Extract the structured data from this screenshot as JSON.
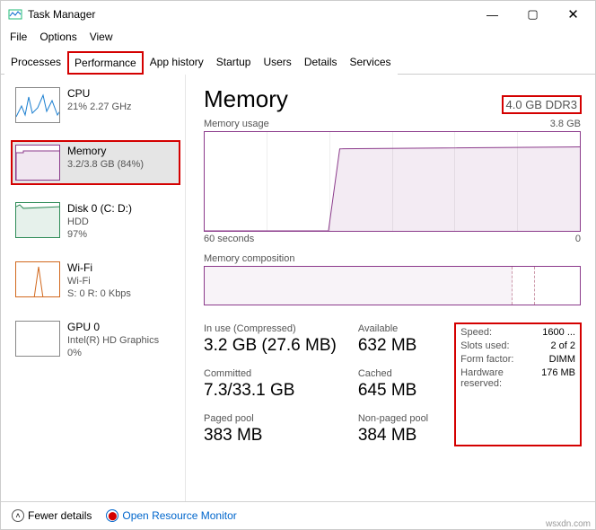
{
  "window": {
    "title": "Task Manager"
  },
  "window_controls": {
    "min": "—",
    "max": "▢",
    "close": "✕"
  },
  "menu": {
    "file": "File",
    "options": "Options",
    "view": "View"
  },
  "tabs": {
    "processes": "Processes",
    "performance": "Performance",
    "app_history": "App history",
    "startup": "Startup",
    "users": "Users",
    "details": "Details",
    "services": "Services"
  },
  "sidebar": {
    "cpu": {
      "title": "CPU",
      "sub": "21%  2.27 GHz"
    },
    "memory": {
      "title": "Memory",
      "sub": "3.2/3.8 GB (84%)"
    },
    "disk": {
      "title": "Disk 0 (C: D:)",
      "sub1": "HDD",
      "sub2": "97%"
    },
    "wifi": {
      "title": "Wi-Fi",
      "sub1": "Wi-Fi",
      "sub2": "S: 0 R: 0 Kbps"
    },
    "gpu": {
      "title": "GPU 0",
      "sub1": "Intel(R) HD Graphics",
      "sub2": "0%"
    }
  },
  "main": {
    "title": "Memory",
    "capacity": "4.0 GB DDR3",
    "usage_label": "Memory usage",
    "usage_max": "3.8 GB",
    "axis_left": "60 seconds",
    "axis_right": "0",
    "comp_label": "Memory composition"
  },
  "stats_left": {
    "in_use_lbl": "In use (Compressed)",
    "in_use_val": "3.2 GB (27.6 MB)",
    "avail_lbl": "Available",
    "avail_val": "632 MB",
    "committed_lbl": "Committed",
    "committed_val": "7.3/33.1 GB",
    "cached_lbl": "Cached",
    "cached_val": "645 MB",
    "paged_lbl": "Paged pool",
    "paged_val": "383 MB",
    "nonpaged_lbl": "Non-paged pool",
    "nonpaged_val": "384 MB"
  },
  "stats_right": {
    "speed_k": "Speed:",
    "speed_v": "1600 ...",
    "slots_k": "Slots used:",
    "slots_v": "2 of 2",
    "form_k": "Form factor:",
    "form_v": "DIMM",
    "hw_k": "Hardware reserved:",
    "hw_v": "176 MB"
  },
  "footer": {
    "fewer": "Fewer details",
    "orm": "Open Resource Monitor"
  },
  "watermark": "wsxdn.com",
  "chart_data": {
    "type": "area",
    "title": "Memory usage",
    "ylabel": "GB",
    "ylim": [
      0,
      3.8
    ],
    "xlim_label": [
      "60 seconds",
      "0"
    ],
    "x_seconds_ago": [
      60,
      55,
      50,
      45,
      40,
      35,
      30,
      25,
      20,
      15,
      10,
      5,
      0
    ],
    "estimated_usage_gb": [
      0,
      0,
      0,
      0,
      0.05,
      3.15,
      3.18,
      3.2,
      3.2,
      3.2,
      3.2,
      3.2,
      3.2
    ]
  },
  "colors": {
    "memory": "#8b3a8b",
    "cpu": "#1b7fd0",
    "disk": "#2e8b57",
    "wifi": "#d2691e",
    "highlight": "#d40000"
  }
}
